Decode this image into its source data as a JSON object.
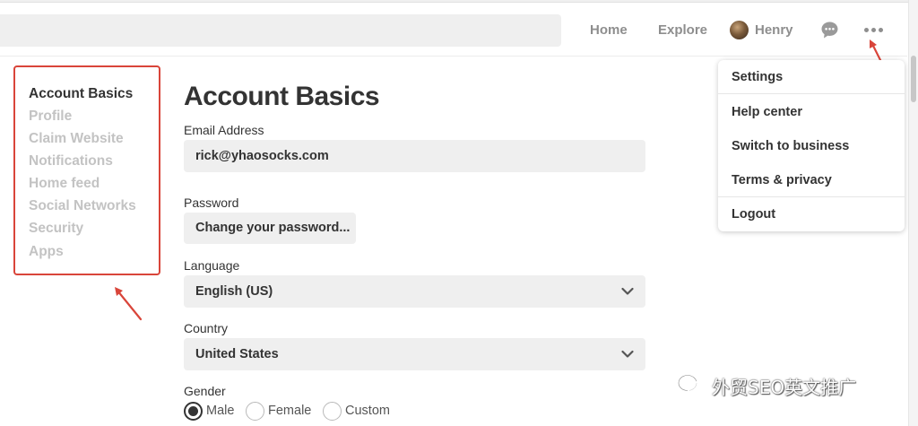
{
  "header": {
    "nav": {
      "home": "Home",
      "explore": "Explore",
      "user": "Henry"
    }
  },
  "sidebar": {
    "items": [
      {
        "label": "Account Basics",
        "active": true
      },
      {
        "label": "Profile"
      },
      {
        "label": "Claim Website"
      },
      {
        "label": "Notifications"
      },
      {
        "label": "Home feed"
      },
      {
        "label": "Social Networks"
      },
      {
        "label": "Security"
      },
      {
        "label": "Apps"
      }
    ]
  },
  "main": {
    "title": "Account Basics",
    "email": {
      "label": "Email Address",
      "value": "rick@yhaosocks.com"
    },
    "password": {
      "label": "Password",
      "button": "Change your password..."
    },
    "language": {
      "label": "Language",
      "value": "English (US)"
    },
    "country": {
      "label": "Country",
      "value": "United States"
    },
    "gender": {
      "label": "Gender",
      "options": [
        "Male",
        "Female",
        "Custom"
      ],
      "selected": "Male"
    }
  },
  "menu": {
    "items": [
      "Settings",
      "Help center",
      "Switch to business",
      "Terms & privacy",
      "Logout"
    ]
  },
  "watermark": {
    "text": "外贸SEO英文推广"
  },
  "colors": {
    "highlight_red": "#d9453a",
    "text": "#333333",
    "muted": "#8e8e8e",
    "field_bg": "#efefef"
  }
}
